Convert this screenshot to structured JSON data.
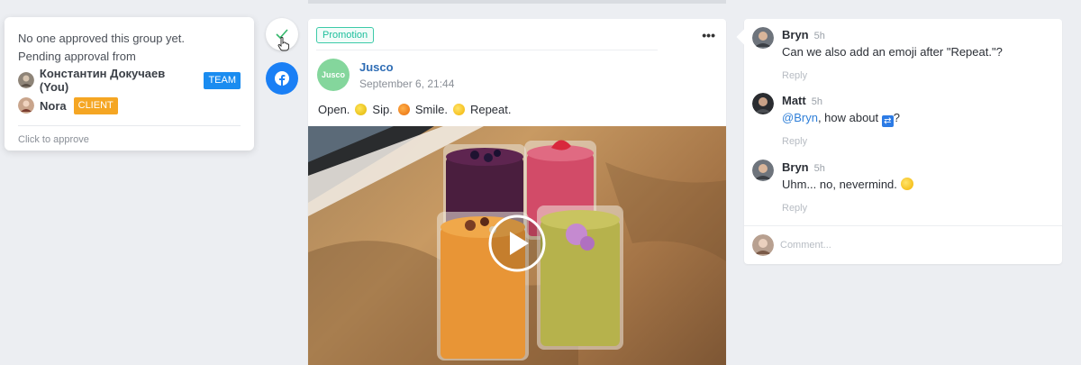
{
  "approval": {
    "status_line": "No one approved this group yet.",
    "pending_label": "Pending approval from",
    "approvers": [
      {
        "name": "Константин Докучаев",
        "you_label": "(You)",
        "role": "TEAM"
      },
      {
        "name": "Nora",
        "role": "CLIENT"
      }
    ],
    "action": "Click to approve"
  },
  "post": {
    "tag": "Promotion",
    "more": "•••",
    "page_initial": "Jusco",
    "page_name": "Jusco",
    "date": "September 6, 21:44",
    "text_parts": [
      "Open.",
      "Sip.",
      "Smile.",
      "Repeat."
    ],
    "emojis": [
      "lemon-emoji",
      "orange-emoji",
      "smile-emoji"
    ]
  },
  "comments": {
    "items": [
      {
        "author": "Bryn",
        "time": "5h",
        "text": "Can we also add an emoji after \"Repeat.\"?",
        "reply": "Reply"
      },
      {
        "author": "Matt",
        "time": "5h",
        "mention": "@Bryn",
        "text": ", how about ",
        "suffix": "?",
        "reply": "Reply"
      },
      {
        "author": "Bryn",
        "time": "5h",
        "text": "Uhm... no, nevermind.",
        "reply": "Reply"
      }
    ],
    "placeholder": "Comment..."
  },
  "colors": {
    "accent": "#1a8cf0",
    "client": "#f5a623",
    "promo": "#1dbf9c",
    "facebook": "#1a7ff5"
  }
}
